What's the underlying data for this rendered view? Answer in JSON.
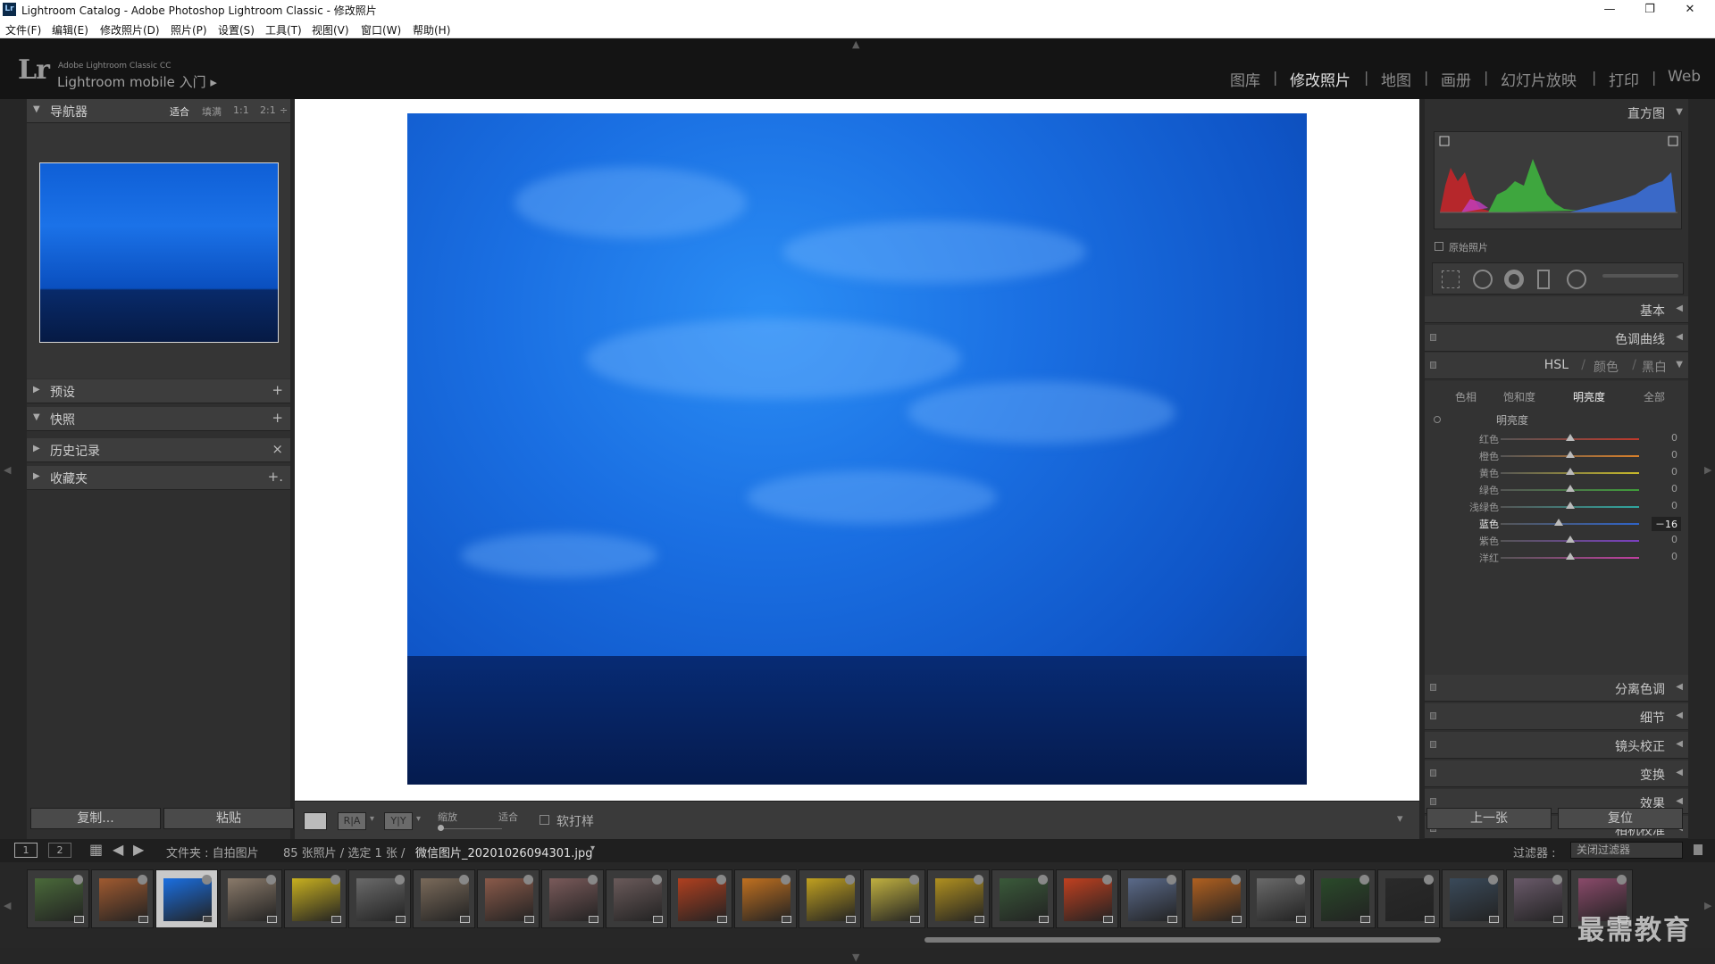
{
  "window": {
    "title": "Lightroom Catalog - Adobe Photoshop Lightroom Classic - 修改照片",
    "logo": "Lr",
    "controls": [
      "—",
      "❐",
      "✕"
    ]
  },
  "menu": [
    "文件(F)",
    "编辑(E)",
    "修改照片(D)",
    "照片(P)",
    "设置(S)",
    "工具(T)",
    "视图(V)",
    "窗口(W)",
    "帮助(H)"
  ],
  "header": {
    "logo": "Lr",
    "brand_small": "Adobe Lightroom Classic CC",
    "brand_main": "Lightroom mobile 入门 ▸"
  },
  "modules": [
    "图库",
    "修改照片",
    "地图",
    "画册",
    "幻灯片放映",
    "打印",
    "Web"
  ],
  "left": {
    "navigator": {
      "title": "导航器",
      "options": [
        "适合",
        "填满",
        "1:1",
        "2:1",
        "÷"
      ]
    },
    "panels": [
      {
        "title": "预设",
        "action": "+"
      },
      {
        "title": "快照",
        "action": "+"
      },
      {
        "title": "历史记录",
        "action": "×"
      },
      {
        "title": "收藏夹",
        "action": "+."
      }
    ],
    "copy_label": "复制...",
    "paste_label": "粘贴"
  },
  "toolbar": {
    "zoom_label": "缩放",
    "zoom_value": "适合",
    "softproof_label": "软打样",
    "view_ra": "R|A",
    "view_yy": "Y|Y",
    "menu_arrow": "▾"
  },
  "right": {
    "histogram_title": "直方图",
    "original_label": "原始照片",
    "panels_top": [
      "基本",
      "色调曲线"
    ],
    "hsl": {
      "title_hsl": "HSL",
      "sep": "/",
      "title_color": "颜色",
      "title_bw": "黑白",
      "tabs": [
        "色相",
        "饱和度",
        "明亮度",
        "全部"
      ],
      "group_label": "明亮度",
      "rows": [
        {
          "label": "红色",
          "value": "0",
          "pos": 0.5,
          "color": "#c0392b"
        },
        {
          "label": "橙色",
          "value": "0",
          "pos": 0.5,
          "color": "#d9802a"
        },
        {
          "label": "黄色",
          "value": "0",
          "pos": 0.5,
          "color": "#c8b92a"
        },
        {
          "label": "绿色",
          "value": "0",
          "pos": 0.5,
          "color": "#3f9d3a"
        },
        {
          "label": "浅绿色",
          "value": "0",
          "pos": 0.5,
          "color": "#2fa7a0"
        },
        {
          "label": "蓝色",
          "value": "－16",
          "pos": 0.42,
          "color": "#2f63c8",
          "active": true
        },
        {
          "label": "紫色",
          "value": "0",
          "pos": 0.5,
          "color": "#7a3fc0"
        },
        {
          "label": "洋红",
          "value": "0",
          "pos": 0.5,
          "color": "#c03fa0"
        }
      ]
    },
    "panels_bottom": [
      "分离色调",
      "细节",
      "镜头校正",
      "变换",
      "效果",
      "相机校准"
    ],
    "prev_label": "上一张",
    "reset_label": "复位"
  },
  "filmbar": {
    "view1": "1",
    "view2": "2",
    "path": "文件夹 : 自拍图片",
    "count": "85 张照片 / 选定 1 张 /",
    "filename": "微信图片_20201026094301.jpg",
    "filename_arrow": "▾",
    "filter_label": "过滤器 :",
    "filter_value": "关闭过滤器"
  },
  "filmstrip": {
    "thumb_colors": [
      "#4a6a3a",
      "#a05a30",
      "#1a6fe2",
      "#8a7a6a",
      "#c8b020",
      "#6a6a6a",
      "#7a6a5a",
      "#8a5a4a",
      "#7a5a5a",
      "#6a5a5a",
      "#b04020",
      "#c07020",
      "#c0a020",
      "#c0b040",
      "#b09020",
      "#3a5a3a",
      "#c04020",
      "#5a6a8a",
      "#b06020",
      "#6a6a6a",
      "#2a4a2a",
      "#2a2a2a",
      "#3a4a5a",
      "#6a5a6a",
      "#8a4a6a"
    ],
    "selected": 2
  },
  "watermark": "最需教育",
  "colors": {
    "accent_blue": "#1a6fe2",
    "panel": "#2f2f2f",
    "header": "#141414"
  }
}
